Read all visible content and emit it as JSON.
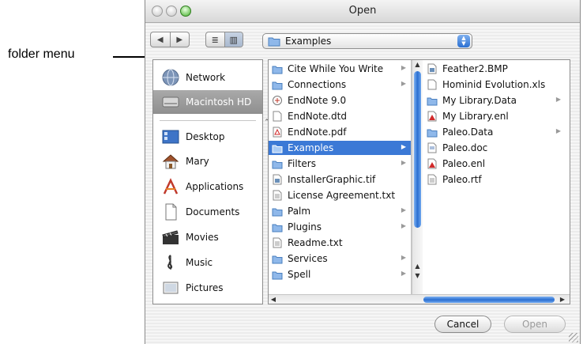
{
  "callout": {
    "label": "folder menu"
  },
  "window": {
    "title": "Open"
  },
  "toolbar": {
    "back": "◀",
    "forward": "▶",
    "list_view": "≣",
    "column_view": "▥",
    "folder_popup_value": "Examples"
  },
  "sidebar": {
    "items": [
      {
        "label": "Network",
        "icon": "network-icon"
      },
      {
        "label": "Macintosh HD",
        "icon": "hard-drive-icon",
        "selected": true
      },
      {
        "label": "Desktop",
        "icon": "desktop-icon"
      },
      {
        "label": "Mary",
        "icon": "home-icon"
      },
      {
        "label": "Applications",
        "icon": "applications-icon"
      },
      {
        "label": "Documents",
        "icon": "documents-icon"
      },
      {
        "label": "Movies",
        "icon": "movies-icon"
      },
      {
        "label": "Music",
        "icon": "music-icon"
      },
      {
        "label": "Pictures",
        "icon": "pictures-icon"
      }
    ]
  },
  "column1": {
    "items": [
      {
        "name": "Cite While You Write",
        "kind": "folder",
        "has_children": true
      },
      {
        "name": "Connections",
        "kind": "folder",
        "has_children": true
      },
      {
        "name": "EndNote 9.0",
        "kind": "app"
      },
      {
        "name": "EndNote.dtd",
        "kind": "doc"
      },
      {
        "name": "EndNote.pdf",
        "kind": "pdf"
      },
      {
        "name": "Examples",
        "kind": "folder",
        "has_children": true,
        "selected": true
      },
      {
        "name": "Filters",
        "kind": "folder",
        "has_children": true
      },
      {
        "name": "InstallerGraphic.tif",
        "kind": "image"
      },
      {
        "name": "License Agreement.txt",
        "kind": "text"
      },
      {
        "name": "Palm",
        "kind": "folder",
        "has_children": true
      },
      {
        "name": "Plugins",
        "kind": "folder",
        "has_children": true
      },
      {
        "name": "Readme.txt",
        "kind": "text"
      },
      {
        "name": "Services",
        "kind": "folder",
        "has_children": true
      },
      {
        "name": "Spell",
        "kind": "folder",
        "has_children": true
      }
    ]
  },
  "column2": {
    "items": [
      {
        "name": "Feather2.BMP",
        "kind": "image"
      },
      {
        "name": "Hominid Evolution.xls",
        "kind": "doc"
      },
      {
        "name": "My Library.Data",
        "kind": "folder",
        "has_children": true
      },
      {
        "name": "My Library.enl",
        "kind": "enl"
      },
      {
        "name": "Paleo.Data",
        "kind": "folder",
        "has_children": true
      },
      {
        "name": "Paleo.doc",
        "kind": "doc"
      },
      {
        "name": "Paleo.enl",
        "kind": "enl"
      },
      {
        "name": "Paleo.rtf",
        "kind": "text"
      }
    ]
  },
  "buttons": {
    "cancel": "Cancel",
    "open": "Open"
  },
  "colors": {
    "selection": "#3b79d6",
    "sidebar_selected": "#999999",
    "scroll_thumb": "#2b6fd1"
  }
}
